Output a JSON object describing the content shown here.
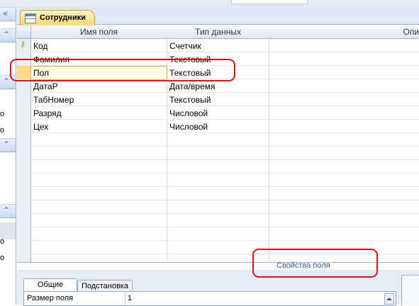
{
  "document_tab": {
    "title": "Сотрудники",
    "icon": "table-icon"
  },
  "grid": {
    "headers": {
      "field_name": "Имя поля",
      "data_type": "Тип данных",
      "description": "Опи"
    },
    "rows": [
      {
        "name": "Код",
        "type": "Счетчик",
        "primary_key": true
      },
      {
        "name": "Фамилия",
        "type": "Текстовый"
      },
      {
        "name": "Пол",
        "type": "Текстовый",
        "current": true
      },
      {
        "name": "ДатаР",
        "type": "Дата/время"
      },
      {
        "name": "ТабНомер",
        "type": "Текстовый"
      },
      {
        "name": "Разряд",
        "type": "Числовой"
      },
      {
        "name": "Цех",
        "type": "Числовой"
      }
    ]
  },
  "field_properties": {
    "title": "Свойства поля",
    "tabs": {
      "general": "Общие",
      "lookup": "Подстановка"
    },
    "row": {
      "label": "Размер поля",
      "value": "1"
    }
  },
  "colors": {
    "annotation": "#e0101b",
    "tab_active": "#ffd76c",
    "panel_bg": "#e4ecf6"
  }
}
